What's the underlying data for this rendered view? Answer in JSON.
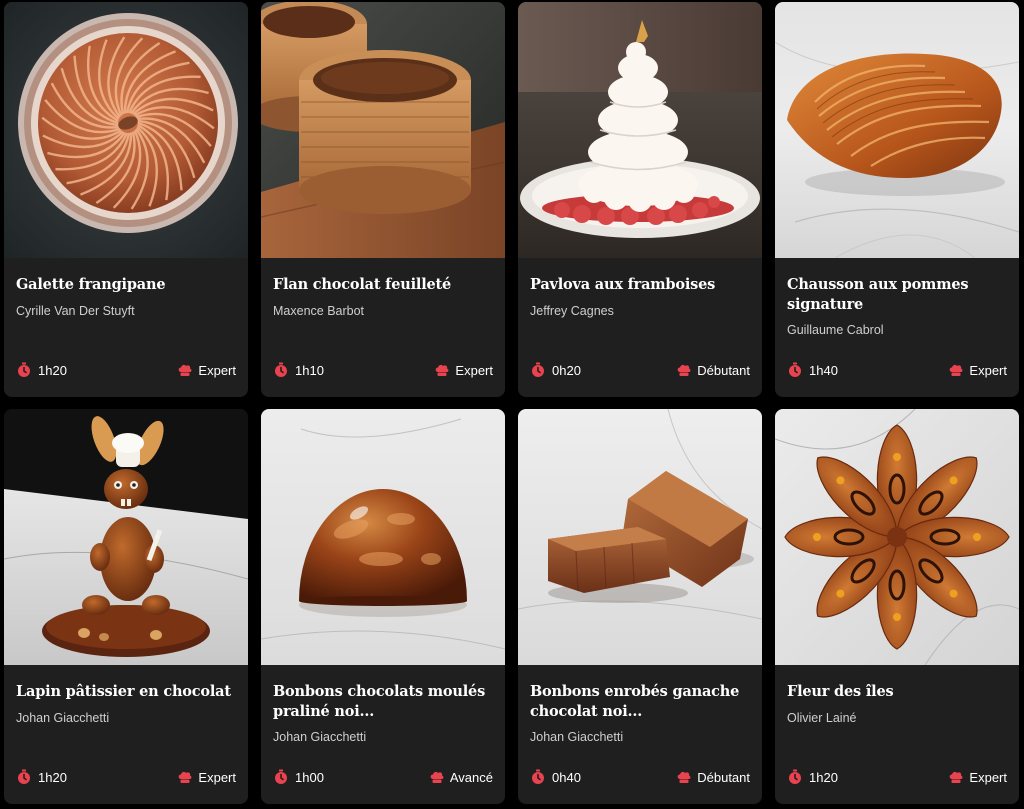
{
  "accent_color": "#e8434f",
  "card_background": "#1f1f1f",
  "page_background": "#000000",
  "recipes": [
    {
      "title": "Galette frangipane",
      "author": "Cyrille Van Der Stuyft",
      "time": "1h20",
      "level": "Expert",
      "time_icon": "timer-icon",
      "level_icon": "chef-hat-icon"
    },
    {
      "title": "Flan chocolat feuilleté",
      "author": "Maxence Barbot",
      "time": "1h10",
      "level": "Expert",
      "time_icon": "timer-icon",
      "level_icon": "chef-hat-icon"
    },
    {
      "title": "Pavlova aux framboises",
      "author": "Jeffrey Cagnes",
      "time": "0h20",
      "level": "Débutant",
      "time_icon": "timer-icon",
      "level_icon": "chef-hat-icon"
    },
    {
      "title": "Chausson aux pommes signature",
      "author": "Guillaume Cabrol",
      "time": "1h40",
      "level": "Expert",
      "time_icon": "timer-icon",
      "level_icon": "chef-hat-icon"
    },
    {
      "title": "Lapin pâtissier en chocolat",
      "author": "Johan Giacchetti",
      "time": "1h20",
      "level": "Expert",
      "time_icon": "timer-icon",
      "level_icon": "chef-hat-icon"
    },
    {
      "title": "Bonbons chocolats moulés praliné noi...",
      "author": "Johan Giacchetti",
      "time": "1h00",
      "level": "Avancé",
      "time_icon": "timer-icon",
      "level_icon": "chef-hat-icon"
    },
    {
      "title": "Bonbons enrobés ganache chocolat noi...",
      "author": "Johan Giacchetti",
      "time": "0h40",
      "level": "Débutant",
      "time_icon": "timer-icon",
      "level_icon": "chef-hat-icon"
    },
    {
      "title": "Fleur des îles",
      "author": "Olivier Lainé",
      "time": "1h20",
      "level": "Expert",
      "time_icon": "timer-icon",
      "level_icon": "chef-hat-icon"
    }
  ]
}
